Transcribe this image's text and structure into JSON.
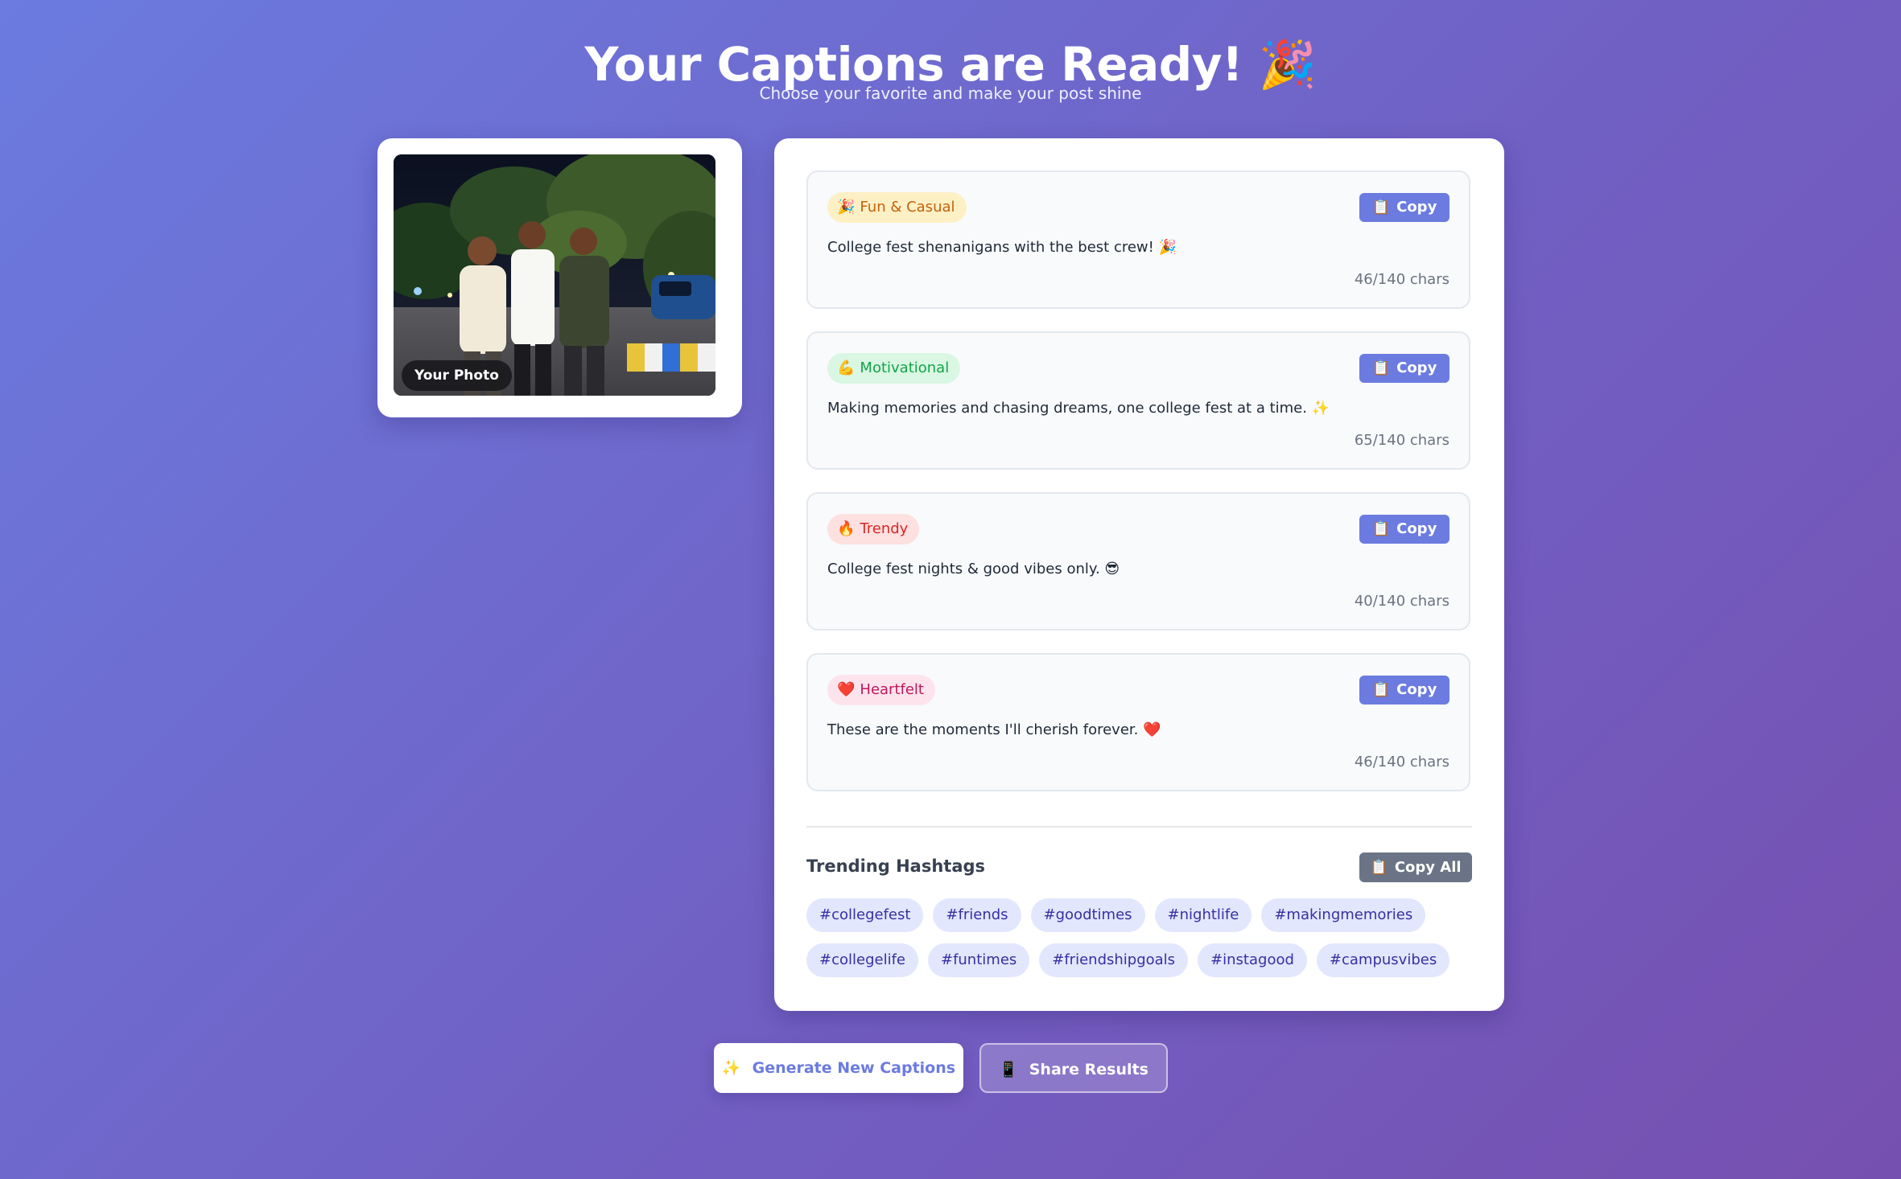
{
  "header": {
    "title": "Your Captions are Ready! 🎉",
    "subtitle": "Choose your favorite and make your post shine"
  },
  "photo": {
    "label": "Your Photo"
  },
  "captions": [
    {
      "icon": "🎉",
      "tag": "Fun & Casual",
      "text": "College fest shenanigans with the best crew! 🎉",
      "count": "46/140 chars",
      "copy_icon": "📋",
      "copy_label": "Copy"
    },
    {
      "icon": "💪",
      "tag": "Motivational",
      "text": "Making memories and chasing dreams, one college fest at a time. ✨",
      "count": "65/140 chars",
      "copy_icon": "📋",
      "copy_label": "Copy"
    },
    {
      "icon": "🔥",
      "tag": "Trendy",
      "text": "College fest nights & good vibes only. 😎",
      "count": "40/140 chars",
      "copy_icon": "📋",
      "copy_label": "Copy"
    },
    {
      "icon": "❤️",
      "tag": "Heartfelt",
      "text": "These are the moments I'll cherish forever. ❤️",
      "count": "46/140 chars",
      "copy_icon": "📋",
      "copy_label": "Copy"
    }
  ],
  "hashtags": {
    "title": "Trending Hashtags",
    "copy_all_icon": "📋",
    "copy_all_label": "Copy All",
    "row1": [
      "#collegefest",
      "#friends",
      "#goodtimes",
      "#nightlife",
      "#makingmemories"
    ],
    "row2": [
      "#collegelife",
      "#funtimes",
      "#friendshipgoals",
      "#instagood",
      "#campusvibes"
    ]
  },
  "actions": {
    "generate_icon": "✨",
    "generate_label": "Generate New Captions",
    "share_icon": "📱",
    "share_label": "Share Results"
  },
  "colors": {
    "accent": "#6b7bdf",
    "background_start": "#6b7bdf",
    "background_end": "#7650b0",
    "hashtag_bg": "#e2e7fd",
    "hashtag_text": "#3730a3"
  }
}
